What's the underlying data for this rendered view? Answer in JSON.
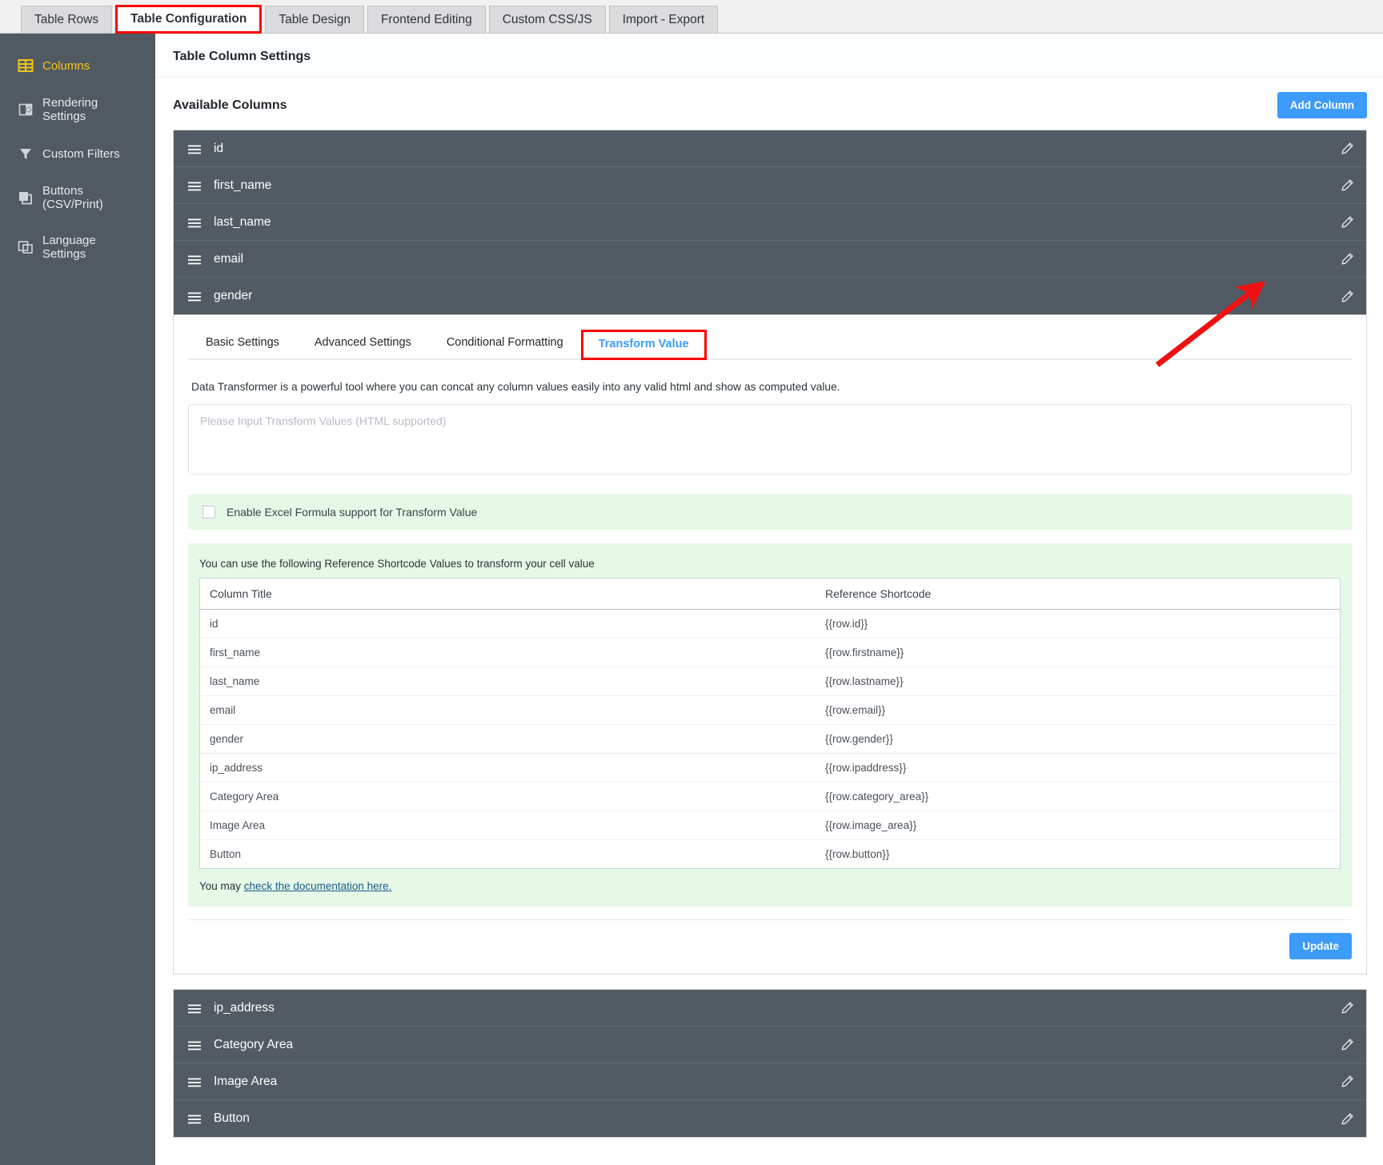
{
  "top_tabs": [
    {
      "label": "Table Rows",
      "state": "normal"
    },
    {
      "label": "Table Configuration",
      "state": "highlight"
    },
    {
      "label": "Table Design",
      "state": "normal"
    },
    {
      "label": "Frontend Editing",
      "state": "normal"
    },
    {
      "label": "Custom CSS/JS",
      "state": "normal"
    },
    {
      "label": "Import - Export",
      "state": "normal"
    }
  ],
  "sidebar": {
    "items": [
      {
        "label": "Columns",
        "icon": "table-columns-icon",
        "active": true
      },
      {
        "label": "Rendering Settings",
        "icon": "render-icon",
        "active": false
      },
      {
        "label": "Custom Filters",
        "icon": "filter-icon",
        "active": false
      },
      {
        "label": "Buttons (CSV/Print)",
        "icon": "buttons-icon",
        "active": false
      },
      {
        "label": "Language Settings",
        "icon": "language-icon",
        "active": false
      }
    ]
  },
  "panel": {
    "title": "Table Column Settings",
    "available_columns_label": "Available Columns",
    "add_column_label": "Add Column"
  },
  "columns_top": [
    {
      "label": "id",
      "grip": "drag-handle-icon",
      "edit": "pencil-icon"
    },
    {
      "label": "first_name",
      "grip": "drag-handle-icon",
      "edit": "pencil-icon"
    },
    {
      "label": "last_name",
      "grip": "drag-handle-icon",
      "edit": "pencil-icon"
    },
    {
      "label": "email",
      "grip": "drag-handle-icon",
      "edit": "pencil-icon"
    },
    {
      "label": "gender",
      "grip": "drag-handle-icon",
      "edit": "pencil-icon"
    }
  ],
  "columns_bottom": [
    {
      "label": "ip_address",
      "grip": "drag-handle-icon",
      "edit": "pencil-icon"
    },
    {
      "label": "Category Area",
      "grip": "drag-handle-icon",
      "edit": "pencil-icon"
    },
    {
      "label": "Image Area",
      "grip": "drag-handle-icon",
      "edit": "pencil-icon"
    },
    {
      "label": "Button",
      "grip": "drag-handle-icon",
      "edit": "pencil-icon"
    }
  ],
  "detail": {
    "sub_tabs": [
      {
        "label": "Basic Settings",
        "selected": false
      },
      {
        "label": "Advanced Settings",
        "selected": false
      },
      {
        "label": "Conditional Formatting",
        "selected": false
      },
      {
        "label": "Transform Value",
        "selected": true
      }
    ],
    "description": "Data Transformer is a powerful tool where you can concat any column values easily into any valid html and show as computed value.",
    "transform_textarea": {
      "value": "",
      "placeholder": "Please Input Transform Values (HTML supported)"
    },
    "excel_checkbox": {
      "label": "Enable Excel Formula support for Transform Value",
      "checked": false
    },
    "reference": {
      "heading": "You can use the following Reference Shortcode Values to transform your cell value",
      "headers": [
        "Column Title",
        "Reference Shortcode"
      ],
      "rows": [
        {
          "title": "id",
          "shortcode": "{{row.id}}"
        },
        {
          "title": "first_name",
          "shortcode": "{{row.firstname}}"
        },
        {
          "title": "last_name",
          "shortcode": "{{row.lastname}}"
        },
        {
          "title": "email",
          "shortcode": "{{row.email}}"
        },
        {
          "title": "gender",
          "shortcode": "{{row.gender}}"
        },
        {
          "title": "ip_address",
          "shortcode": "{{row.ipaddress}}"
        },
        {
          "title": "Category Area",
          "shortcode": "{{row.category_area}}"
        },
        {
          "title": "Image Area",
          "shortcode": "{{row.image_area}}"
        },
        {
          "title": "Button",
          "shortcode": "{{row.button}}"
        }
      ],
      "footer_prefix": "You may ",
      "footer_link": "check the documentation here."
    },
    "update_label": "Update"
  },
  "annotations": {
    "arrow_color": "#ee1111",
    "highlight_box_color": "#ff0000"
  },
  "colors": {
    "accent_blue": "#3d9bfa",
    "sidebar_bg": "#515a62",
    "row_bg": "#525b63",
    "active_menu": "#f5c518",
    "green_panel": "#e6f9e6"
  }
}
